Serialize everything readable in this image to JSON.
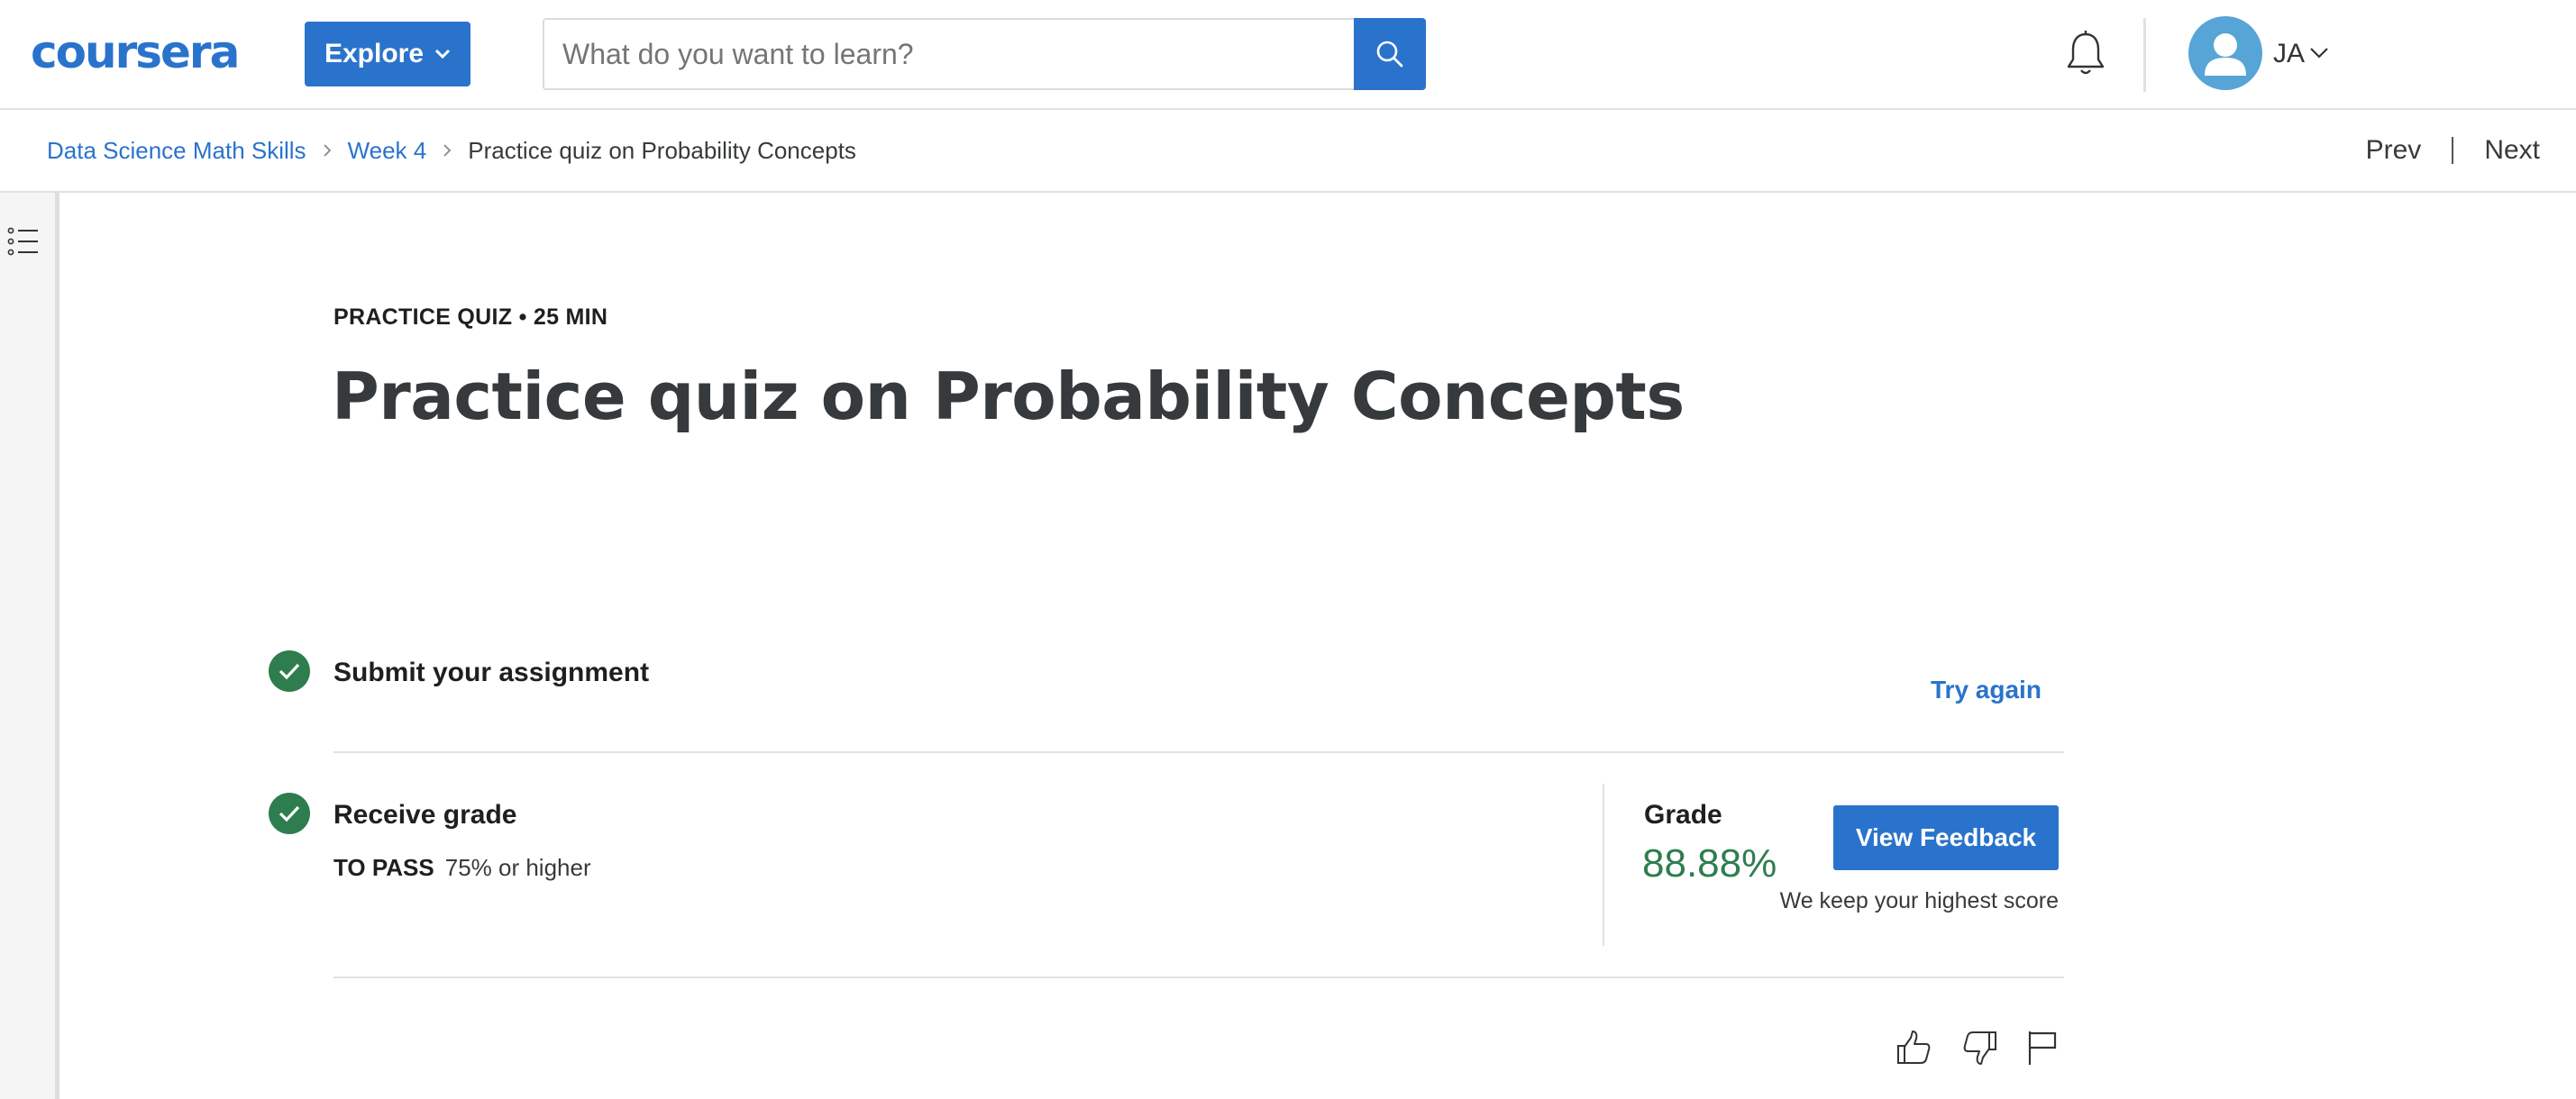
{
  "header": {
    "logo": "coursera",
    "explore_label": "Explore",
    "search": {
      "placeholder": "What do you want to learn?",
      "value": ""
    },
    "user": {
      "initials": "JA"
    },
    "icons": [
      "chevron-down-icon",
      "search-icon",
      "bell-icon",
      "avatar-user-icon"
    ]
  },
  "breadcrumb": {
    "items": [
      {
        "label": "Data Science Math Skills",
        "link": true
      },
      {
        "label": "Week 4",
        "link": true
      },
      {
        "label": "Practice quiz on Probability Concepts",
        "link": false
      }
    ],
    "prev_label": "Prev",
    "next_label": "Next"
  },
  "quiz": {
    "eyebrow": "PRACTICE QUIZ • 25 MIN",
    "title": "Practice quiz on Probability Concepts",
    "steps": [
      {
        "label": "Submit your assignment",
        "done": true
      },
      {
        "label": "Receive grade",
        "done": true
      }
    ],
    "try_again_label": "Try again",
    "to_pass_label": "TO PASS",
    "to_pass_value": "75% or higher",
    "grade_label": "Grade",
    "grade_value": "88.88%",
    "view_feedback_label": "View Feedback",
    "keep_note": "We keep your highest score"
  },
  "colors": {
    "brand_blue": "#2a73cc",
    "success_green": "#2e7d4f",
    "text_dark": "#373a3c",
    "divider": "#e1e1e1"
  },
  "reaction_icons": [
    "thumbs-up-icon",
    "thumbs-down-icon",
    "flag-icon"
  ]
}
